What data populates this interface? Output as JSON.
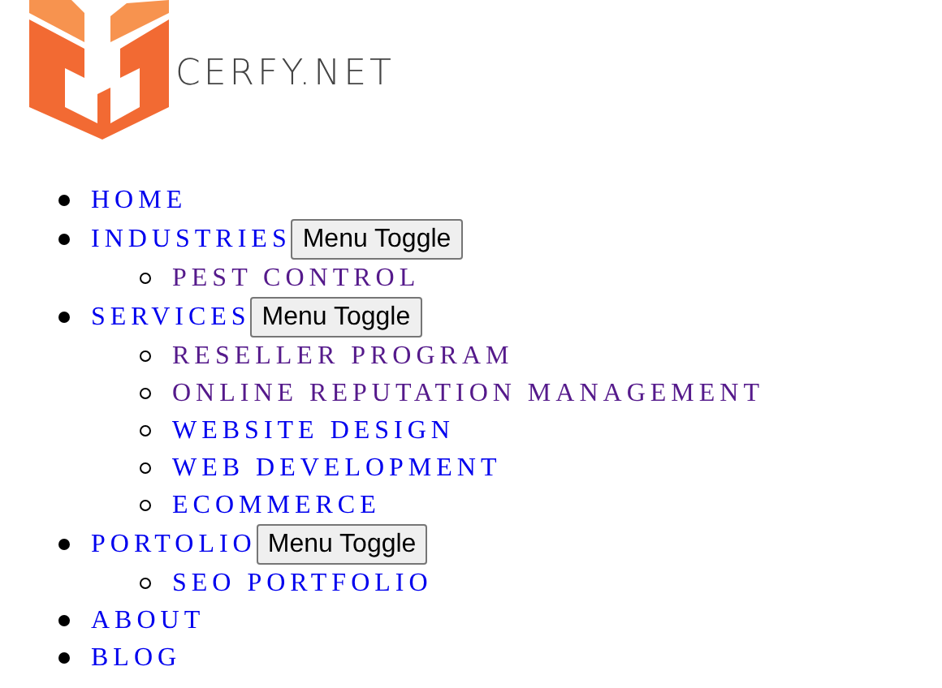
{
  "logo": {
    "text": "CERFY.NET"
  },
  "menu": [
    {
      "label": "HOME",
      "visited": false
    },
    {
      "label": "INDUSTRIES",
      "visited": false,
      "toggle": "Menu Toggle",
      "children": [
        {
          "label": "PEST CONTROL",
          "visited": true
        }
      ]
    },
    {
      "label": "SERVICES",
      "visited": false,
      "toggle": "Menu Toggle",
      "children": [
        {
          "label": "RESELLER PROGRAM",
          "visited": true
        },
        {
          "label": "ONLINE REPUTATION MANAGEMENT",
          "visited": true
        },
        {
          "label": "WEBSITE DESIGN",
          "visited": false
        },
        {
          "label": "WEB DEVELOPMENT",
          "visited": false
        },
        {
          "label": "ECOMMERCE",
          "visited": false
        }
      ]
    },
    {
      "label": "PORTOLIO",
      "visited": false,
      "toggle": "Menu Toggle",
      "children": [
        {
          "label": "SEO PORTFOLIO",
          "visited": false
        }
      ]
    },
    {
      "label": "ABOUT",
      "visited": false
    },
    {
      "label": "BLOG",
      "visited": false
    }
  ]
}
